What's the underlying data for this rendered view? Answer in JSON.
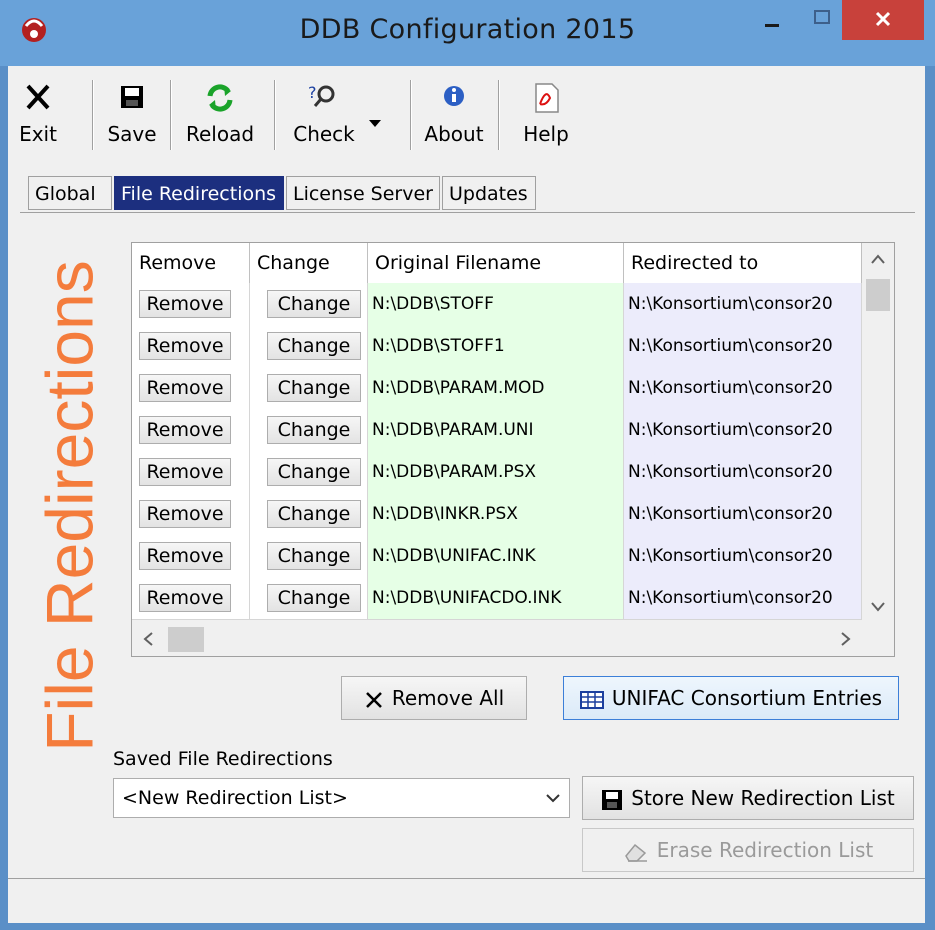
{
  "window": {
    "title": "DDB Configuration 2015",
    "min_symbol": "—",
    "max_symbol": "□",
    "close_symbol": "✕"
  },
  "toolbar": {
    "exit_label": "Exit",
    "save_label": "Save",
    "reload_label": "Reload",
    "check_label": "Check",
    "about_label": "About",
    "help_label": "Help"
  },
  "tabs": [
    {
      "label": "Global"
    },
    {
      "label": "File Redirections",
      "active": true
    },
    {
      "label": "License Server"
    },
    {
      "label": "Updates"
    }
  ],
  "side_title": "File Redirections",
  "table": {
    "columns": [
      "Remove",
      "Change",
      "Original Filename",
      "Redirected to"
    ],
    "rows": [
      {
        "remove": "Remove",
        "change": "Change",
        "original": "N:\\DDB\\STOFF",
        "redirected": "N:\\Konsortium\\consor20"
      },
      {
        "remove": "Remove",
        "change": "Change",
        "original": "N:\\DDB\\STOFF1",
        "redirected": "N:\\Konsortium\\consor20"
      },
      {
        "remove": "Remove",
        "change": "Change",
        "original": "N:\\DDB\\PARAM.MOD",
        "redirected": "N:\\Konsortium\\consor20"
      },
      {
        "remove": "Remove",
        "change": "Change",
        "original": "N:\\DDB\\PARAM.UNI",
        "redirected": "N:\\Konsortium\\consor20"
      },
      {
        "remove": "Remove",
        "change": "Change",
        "original": "N:\\DDB\\PARAM.PSX",
        "redirected": "N:\\Konsortium\\consor20"
      },
      {
        "remove": "Remove",
        "change": "Change",
        "original": "N:\\DDB\\INKR.PSX",
        "redirected": "N:\\Konsortium\\consor20"
      },
      {
        "remove": "Remove",
        "change": "Change",
        "original": "N:\\DDB\\UNIFAC.INK",
        "redirected": "N:\\Konsortium\\consor20"
      },
      {
        "remove": "Remove",
        "change": "Change",
        "original": "N:\\DDB\\UNIFACDO.INK",
        "redirected": "N:\\Konsortium\\consor20"
      }
    ]
  },
  "buttons": {
    "remove_all": "Remove All",
    "unifac_entries": "UNIFAC Consortium Entries",
    "store_list": "Store New Redirection List",
    "erase_list": "Erase Redirection List"
  },
  "saved": {
    "label": "Saved File Redirections",
    "selected": "<New Redirection List>"
  },
  "colors": {
    "title_bar": "#69a2d9",
    "close_button": "#c8413b",
    "active_tab": "#1c2f7f",
    "side_title": "#f47c3c",
    "original_cell": "#e6ffe6",
    "redirected_cell": "#ececfb"
  }
}
